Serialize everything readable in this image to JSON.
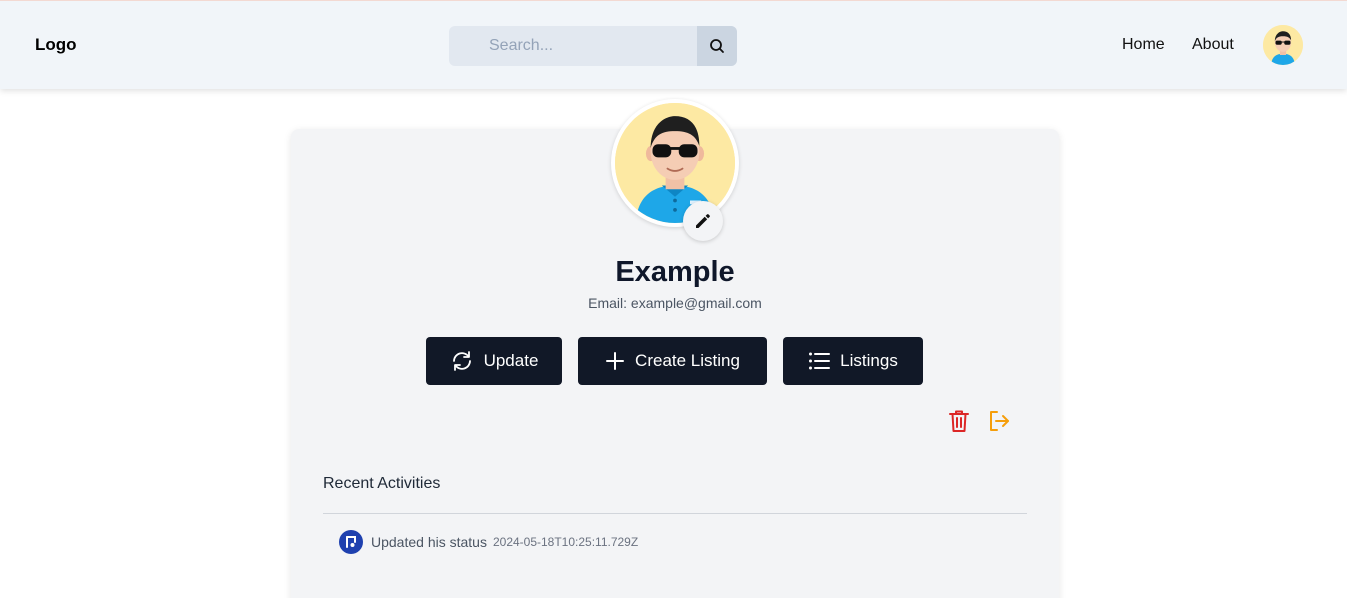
{
  "header": {
    "logo": "Logo",
    "search_placeholder": "Search...",
    "nav": {
      "home": "Home",
      "about": "About"
    }
  },
  "profile": {
    "name": "Example",
    "email": "Email: example@gmail.com",
    "avatar_icon": "avatar-sunglasses"
  },
  "actions": {
    "update_label": "Update",
    "create_listing_label": "Create Listing",
    "listings_label": "Listings",
    "delete_icon": "trash-icon",
    "logout_icon": "sign-out-icon"
  },
  "activities": {
    "title": "Recent Activities",
    "items": [
      {
        "text": "Updated his status",
        "timestamp": "2024-05-18T10:25:11.729Z"
      }
    ]
  },
  "colors": {
    "header_bg": "#f1f5f9",
    "button_bg": "#111827",
    "delete": "#dc2626",
    "logout": "#f59e0b",
    "activity_icon": "#1e40af"
  }
}
